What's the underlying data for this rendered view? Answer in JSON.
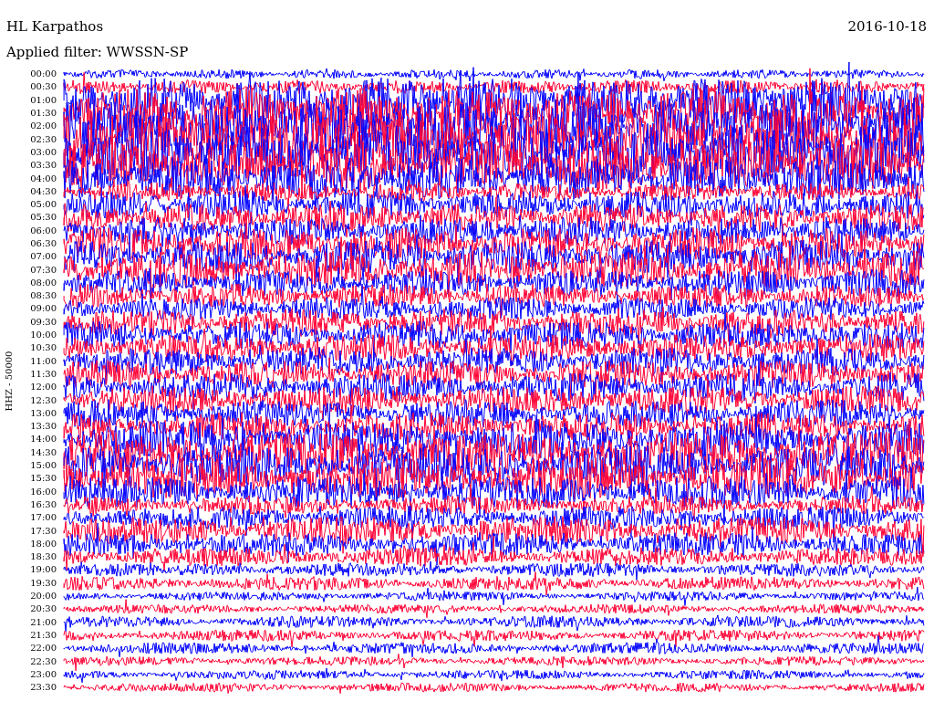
{
  "header": {
    "station": "HL Karpathos",
    "date": "2016-10-18",
    "filter": "Applied filter: WWSSN-SP"
  },
  "channel_label": "HHZ - 50000",
  "rows": [
    {
      "time": "00:00",
      "color": "#0000ff"
    },
    {
      "time": "00:30",
      "color": "#ff0033"
    },
    {
      "time": "01:00",
      "color": "#0000ff"
    },
    {
      "time": "01:30",
      "color": "#ff0033"
    },
    {
      "time": "02:00",
      "color": "#0000ff"
    },
    {
      "time": "02:30",
      "color": "#ff0033"
    },
    {
      "time": "03:00",
      "color": "#0000ff"
    },
    {
      "time": "03:30",
      "color": "#ff0033"
    },
    {
      "time": "04:00",
      "color": "#0000ff"
    },
    {
      "time": "04:30",
      "color": "#ff0033"
    },
    {
      "time": "05:00",
      "color": "#0000ff"
    },
    {
      "time": "05:30",
      "color": "#ff0033"
    },
    {
      "time": "06:00",
      "color": "#0000ff"
    },
    {
      "time": "06:30",
      "color": "#ff0033"
    },
    {
      "time": "07:00",
      "color": "#0000ff"
    },
    {
      "time": "07:30",
      "color": "#ff0033"
    },
    {
      "time": "08:00",
      "color": "#0000ff"
    },
    {
      "time": "08:30",
      "color": "#ff0033"
    },
    {
      "time": "09:00",
      "color": "#0000ff"
    },
    {
      "time": "09:30",
      "color": "#ff0033"
    },
    {
      "time": "10:00",
      "color": "#0000ff"
    },
    {
      "time": "10:30",
      "color": "#ff0033"
    },
    {
      "time": "11:00",
      "color": "#0000ff"
    },
    {
      "time": "11:30",
      "color": "#ff0033"
    },
    {
      "time": "12:00",
      "color": "#0000ff"
    },
    {
      "time": "12:30",
      "color": "#ff0033"
    },
    {
      "time": "13:00",
      "color": "#0000ff"
    },
    {
      "time": "13:30",
      "color": "#ff0033"
    },
    {
      "time": "14:00",
      "color": "#0000ff"
    },
    {
      "time": "14:30",
      "color": "#ff0033"
    },
    {
      "time": "15:00",
      "color": "#0000ff"
    },
    {
      "time": "15:30",
      "color": "#ff0033"
    },
    {
      "time": "16:00",
      "color": "#0000ff"
    },
    {
      "time": "16:30",
      "color": "#ff0033"
    },
    {
      "time": "17:00",
      "color": "#0000ff"
    },
    {
      "time": "17:30",
      "color": "#ff0033"
    },
    {
      "time": "18:00",
      "color": "#0000ff"
    },
    {
      "time": "18:30",
      "color": "#ff0033"
    },
    {
      "time": "19:00",
      "color": "#0000ff"
    },
    {
      "time": "19:30",
      "color": "#ff0033"
    },
    {
      "time": "20:00",
      "color": "#0000ff"
    },
    {
      "time": "20:30",
      "color": "#ff0033"
    },
    {
      "time": "21:00",
      "color": "#0000ff"
    },
    {
      "time": "21:30",
      "color": "#ff0033"
    },
    {
      "time": "22:00",
      "color": "#0000ff"
    },
    {
      "time": "22:30",
      "color": "#ff0033"
    },
    {
      "time": "23:00",
      "color": "#0000ff"
    },
    {
      "time": "23:30",
      "color": "#ff0033"
    }
  ]
}
